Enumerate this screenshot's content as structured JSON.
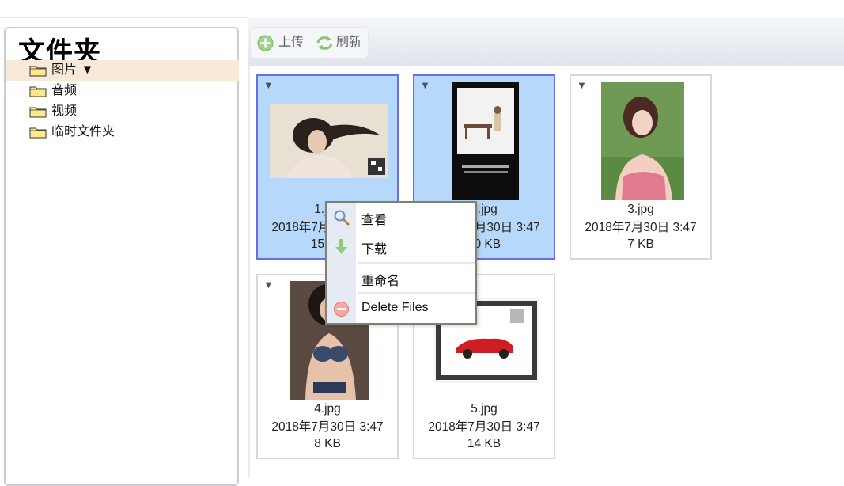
{
  "sidebar": {
    "title": "文件夹",
    "items": [
      {
        "label": "图片",
        "caret": "▼",
        "selected": true
      },
      {
        "label": "音频"
      },
      {
        "label": "视频"
      },
      {
        "label": "临时文件夹"
      }
    ]
  },
  "toolbar": {
    "upload_label": "上传",
    "refresh_label": "刷新",
    "upload_icon": "add-circle-icon",
    "refresh_icon": "refresh-icon"
  },
  "files": [
    {
      "name": "1.jpg",
      "date": "2018年7月30日 3:47",
      "size": "15 KB",
      "selected": true
    },
    {
      "name": "2.jpg",
      "date": "2018年7月30日 3:47",
      "size": "10 KB",
      "selected": true
    },
    {
      "name": "3.jpg",
      "date": "2018年7月30日 3:47",
      "size": "7 KB",
      "selected": false
    },
    {
      "name": "4.jpg",
      "date": "2018年7月30日 3:47",
      "size": "8 KB",
      "selected": false
    },
    {
      "name": "5.jpg",
      "date": "2018年7月30日 3:47",
      "size": "14 KB",
      "selected": false
    }
  ],
  "file_menu_glyph": "▼",
  "context_menu": {
    "view_label": "查看",
    "download_label": "下载",
    "rename_label": "重命名",
    "delete_label": "Delete Files",
    "icons": [
      "magnifier-icon",
      "download-arrow-icon",
      "",
      "delete-icon"
    ]
  },
  "colors": {
    "selected_tile_bg": "#b6d8fa",
    "selected_tile_border": "#6c6ce8",
    "sidebar_selected_bg": "#f8e9d8",
    "accent_green": "#7cc46b"
  }
}
